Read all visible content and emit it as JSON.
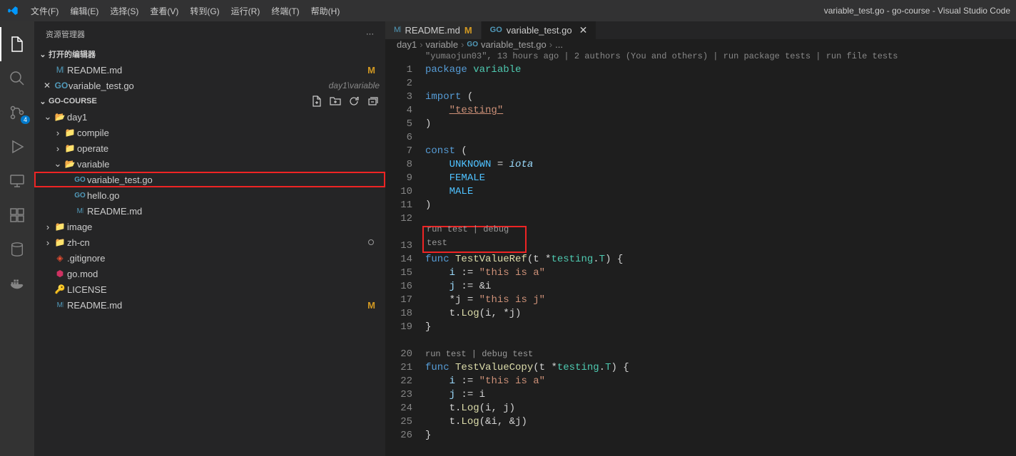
{
  "window": {
    "title": "variable_test.go - go-course - Visual Studio Code"
  },
  "menu": [
    "文件(F)",
    "编辑(E)",
    "选择(S)",
    "查看(V)",
    "转到(G)",
    "运行(R)",
    "终端(T)",
    "帮助(H)"
  ],
  "activity": {
    "scm_badge": "4"
  },
  "sidebar": {
    "title": "资源管理器",
    "open_editors_label": "打开的编辑器",
    "workspace_label": "GO-COURSE",
    "open_editors": [
      {
        "name": "README.md",
        "icon": "md",
        "badge": "M"
      },
      {
        "name": "variable_test.go",
        "icon": "go",
        "meta": "day1\\variable",
        "close": true
      }
    ],
    "tree": [
      {
        "depth": 0,
        "chev": "down",
        "icon": "folder-open",
        "name": "day1"
      },
      {
        "depth": 1,
        "chev": "right",
        "icon": "folder",
        "name": "compile"
      },
      {
        "depth": 1,
        "chev": "right",
        "icon": "folder",
        "name": "operate"
      },
      {
        "depth": 1,
        "chev": "down",
        "icon": "folder-open",
        "name": "variable"
      },
      {
        "depth": 2,
        "icon": "go",
        "name": "variable_test.go",
        "highlight": true
      },
      {
        "depth": 2,
        "icon": "go",
        "name": "hello.go"
      },
      {
        "depth": 2,
        "icon": "md",
        "name": "README.md"
      },
      {
        "depth": 0,
        "chev": "right",
        "icon": "folder-img",
        "name": "image"
      },
      {
        "depth": 0,
        "chev": "right",
        "icon": "folder",
        "name": "zh-cn",
        "dot": true
      },
      {
        "depth": 0,
        "icon": "git",
        "name": ".gitignore"
      },
      {
        "depth": 0,
        "icon": "gomod",
        "name": "go.mod"
      },
      {
        "depth": 0,
        "icon": "license",
        "name": "LICENSE"
      },
      {
        "depth": 0,
        "icon": "md",
        "name": "README.md",
        "badge": "M"
      }
    ]
  },
  "tabs": [
    {
      "icon": "md",
      "name": "README.md",
      "modified": "M"
    },
    {
      "icon": "go",
      "name": "variable_test.go",
      "active": true,
      "close": true
    }
  ],
  "breadcrumbs": {
    "parts": [
      "day1",
      "variable",
      "variable_test.go",
      "..."
    ]
  },
  "editor": {
    "blame": "\"yumaojun03\", 13 hours ago | 2 authors (You and others) | run package tests | run file tests",
    "codelens1": "run test | debug test",
    "codelens2": "run test | debug test",
    "lines": {
      "l1_a": "package",
      "l1_b": "variable",
      "l3_a": "import",
      "l3_b": "(",
      "l4": "\"testing\"",
      "l5": ")",
      "l7_a": "const",
      "l7_b": "(",
      "l8_a": "UNKNOWN",
      "l8_b": "=",
      "l8_c": "iota",
      "l9": "FEMALE",
      "l10": "MALE",
      "l11": ")",
      "l13_a": "func",
      "l13_b": "TestValueRef",
      "l13_c": "(t *",
      "l13_d": "testing",
      "l13_e": ".",
      "l13_f": "T",
      "l13_g": ") {",
      "l14_a": "i",
      "l14_b": ":=",
      "l14_c": "\"this is a\"",
      "l15_a": "j",
      "l15_b": ":=",
      "l15_c": "&i",
      "l16_a": "*j",
      "l16_b": "=",
      "l16_c": "\"this is j\"",
      "l17_a": "t.",
      "l17_b": "Log",
      "l17_c": "(i, *j)",
      "l18": "}",
      "l20_a": "func",
      "l20_b": "TestValueCopy",
      "l20_c": "(t *",
      "l20_d": "testing",
      "l20_e": ".",
      "l20_f": "T",
      "l20_g": ") {",
      "l21_a": "i",
      "l21_b": ":=",
      "l21_c": "\"this is a\"",
      "l22_a": "j",
      "l22_b": ":=",
      "l22_c": "i",
      "l23_a": "t.",
      "l23_b": "Log",
      "l23_c": "(i, j)",
      "l24_a": "t.",
      "l24_b": "Log",
      "l24_c": "(&i, &j)",
      "l25": "}"
    }
  }
}
